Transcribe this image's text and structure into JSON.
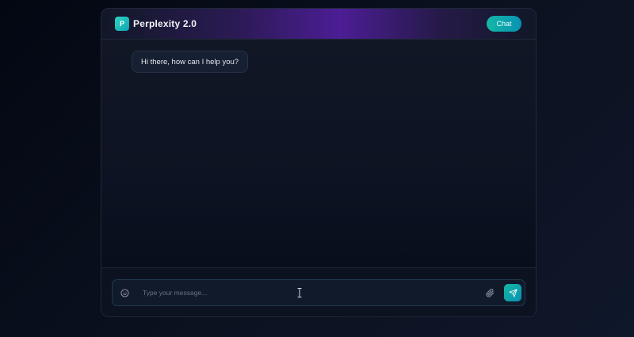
{
  "app": {
    "logo_letter": "P",
    "title": "Perplexity 2.0",
    "chat_button": "Chat"
  },
  "messages": [
    {
      "role": "assistant",
      "text": "Hi there, how can I help you?"
    }
  ],
  "composer": {
    "placeholder": "Type your message...",
    "value": "",
    "icons": [
      "smile-icon",
      "paperclip-icon",
      "send-icon"
    ]
  },
  "colors": {
    "accent": "#14b8a6",
    "header_purple": "#4c1d95",
    "background": "#0b1220"
  }
}
